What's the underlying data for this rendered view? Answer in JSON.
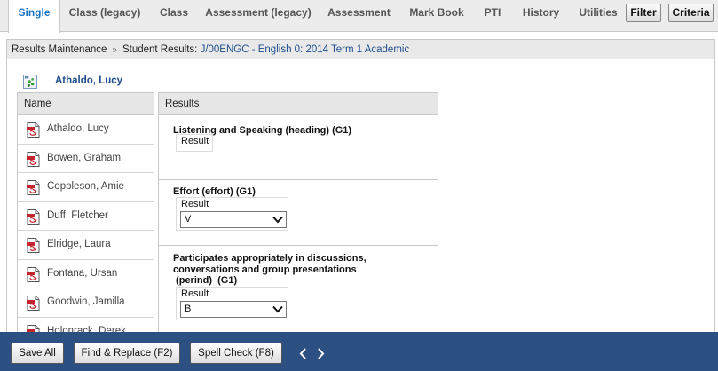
{
  "tabs": [
    {
      "label": "Single",
      "active": true
    },
    {
      "label": "Class (legacy)",
      "active": false
    },
    {
      "label": "Class",
      "active": false
    },
    {
      "label": "Assessment (legacy)",
      "active": false
    },
    {
      "label": "Assessment",
      "active": false
    },
    {
      "label": "Mark Book",
      "active": false
    },
    {
      "label": "PTI",
      "active": false
    },
    {
      "label": "History",
      "active": false
    },
    {
      "label": "Utilities",
      "active": false
    }
  ],
  "tab_buttons": {
    "filter": "Filter",
    "criteria": "Criteria"
  },
  "breadcrumb": {
    "root": "Results Maintenance",
    "separator": "»",
    "label": "Student Results:",
    "link": "J/00ENGC - English 0: 2014 Term 1 Academic"
  },
  "student": {
    "name": "Athaldo, Lucy",
    "icon": "student-group-icon"
  },
  "name_column": {
    "header": "Name",
    "icon": "pdf-report-icon",
    "students": [
      "Athaldo, Lucy",
      "Bowen, Graham",
      "Coppleson, Amie",
      "Duff, Fletcher",
      "Elridge, Laura",
      "Fontana, Ursan",
      "Goodwin, Jamilla",
      "Holonrack, Derek"
    ]
  },
  "results_column": {
    "header": "Results",
    "items": [
      {
        "title": "Listening and Speaking  (heading)  (G1)",
        "result_label": "Result",
        "value": null
      },
      {
        "title": "Effort  (effort)  (G1)",
        "result_label": "Result",
        "value": "V"
      },
      {
        "title_lines": [
          "Participates appropriately in discussions,",
          "conversations and group presentations",
          " (perind)  (G1)"
        ],
        "result_label": "Result",
        "value": "B"
      }
    ]
  },
  "toolbar": {
    "save_all": "Save All",
    "find_replace": "Find & Replace (F2)",
    "spell_check": "Spell Check (F8)"
  },
  "colors": {
    "accent": "#1a74c4",
    "link": "#1f4e8c",
    "toolbar_bg": "#2d5083",
    "pdf_red": "#c0262c"
  }
}
